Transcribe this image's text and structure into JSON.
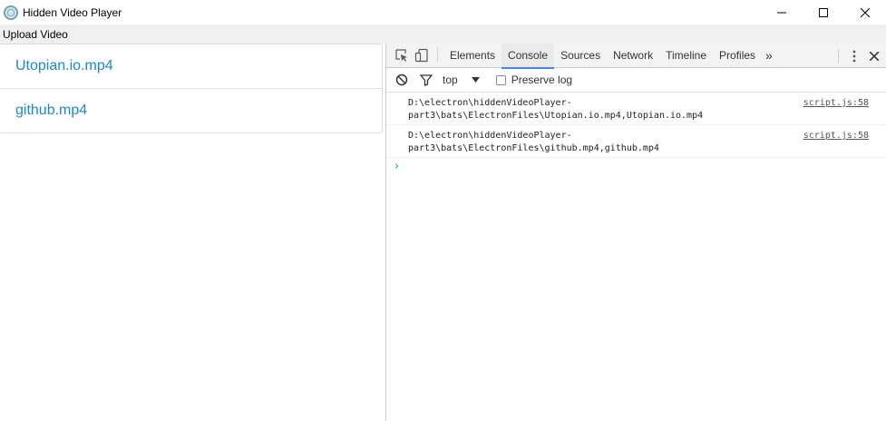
{
  "window": {
    "title": "Hidden Video Player"
  },
  "menubar": {
    "upload_label": "Upload Video"
  },
  "videos": [
    {
      "label": "Utopian.io.mp4"
    },
    {
      "label": "github.mp4"
    }
  ],
  "devtools": {
    "tabs": [
      "Elements",
      "Console",
      "Sources",
      "Network",
      "Timeline",
      "Profiles"
    ],
    "active_tab": "Console",
    "more_tabs_glyph": "»",
    "context": "top",
    "preserve_log_label": "Preserve log",
    "preserve_log_checked": false,
    "messages": [
      {
        "line1": "D:\\electron\\hiddenVideoPlayer-",
        "line2": "part3\\bats\\ElectronFiles\\Utopian.io.mp4,Utopian.io.mp4",
        "source": "script.js:58"
      },
      {
        "line1": "D:\\electron\\hiddenVideoPlayer-",
        "line2": "part3\\bats\\ElectronFiles\\github.mp4,github.mp4",
        "source": "script.js:58"
      }
    ],
    "prompt_glyph": "›",
    "accent_color": "#4285f4"
  },
  "icons": {
    "app": "electron-app-icon",
    "minimize": "minimize-icon",
    "maximize": "maximize-icon",
    "close": "close-icon",
    "inspect": "inspect-element-icon",
    "device": "device-mode-icon",
    "kebab": "more-options-icon",
    "devtools_close": "close-devtools-icon",
    "clear": "clear-console-icon",
    "filter": "filter-icon",
    "dropdown": "dropdown-arrow-icon"
  },
  "colors": {
    "link": "#1a87d8",
    "menubar_bg": "#f0f0f0",
    "devtools_toolbar_bg": "#f3f3f3"
  }
}
